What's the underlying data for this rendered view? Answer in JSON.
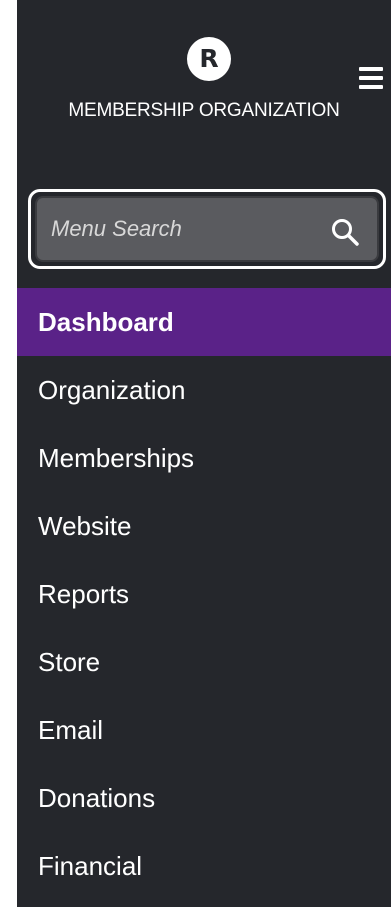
{
  "brand": {
    "logo_letter": "R",
    "org_name": "MEMBERSHIP ORGANIZATION"
  },
  "search": {
    "placeholder": "Menu Search",
    "value": ""
  },
  "menu": {
    "items": [
      {
        "label": "Dashboard",
        "active": true
      },
      {
        "label": "Organization",
        "active": false
      },
      {
        "label": "Memberships",
        "active": false
      },
      {
        "label": "Website",
        "active": false
      },
      {
        "label": "Reports",
        "active": false
      },
      {
        "label": "Store",
        "active": false
      },
      {
        "label": "Email",
        "active": false
      },
      {
        "label": "Donations",
        "active": false
      },
      {
        "label": "Financial",
        "active": false
      }
    ]
  },
  "colors": {
    "sidebar_bg": "#25272c",
    "active_item_bg": "#5a2288",
    "search_bg": "#5a5b5f",
    "text": "#ffffff"
  },
  "icons": {
    "logo": "circle-letter-logo",
    "menu_toggle": "hamburger-icon",
    "search": "search-icon"
  }
}
